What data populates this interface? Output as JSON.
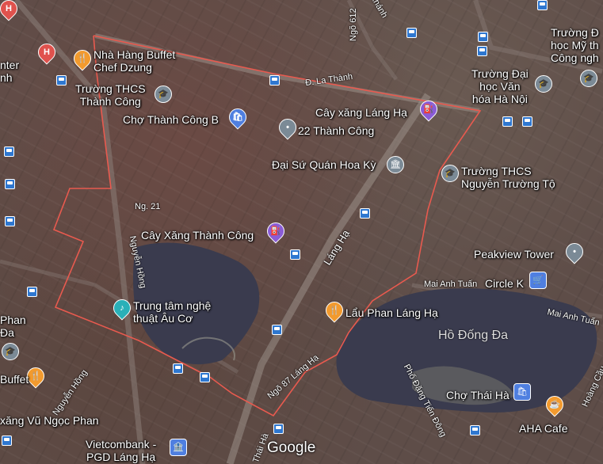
{
  "map": {
    "boundary_color": "#e85a4f",
    "water_color": "#3a3b4e",
    "attribution": "Google"
  },
  "places": [
    {
      "id": "buffet",
      "text": "Nhà Hàng Buffet\nChef Dzung",
      "icon": "restaurant-icon",
      "color": "#f29a2e"
    },
    {
      "id": "thcs-tc",
      "text": "Trường THCS\nThành Công",
      "icon": "school-icon",
      "color": "#7b8a96"
    },
    {
      "id": "cho-tc",
      "text": "Chợ Thành Công B",
      "icon": "shopping-icon",
      "color": "#4f7fe0"
    },
    {
      "id": "22tc",
      "text": "22 Thành Công",
      "icon": "location-icon",
      "color": "#7b8a96"
    },
    {
      "id": "cayxang-lh",
      "text": "Cây xăng Láng Hạ",
      "icon": "gas-station-icon",
      "color": "#8a5cd6"
    },
    {
      "id": "dsq",
      "text": "Đại Sứ Quán Hoa Kỳ",
      "icon": "embassy-icon",
      "color": "#7b8a96"
    },
    {
      "id": "thcs-ntt",
      "text": "Trường THCS\nNguyễn Trường Tộ",
      "icon": "school-icon",
      "color": "#7b8a96"
    },
    {
      "id": "daihoc",
      "text": "Trường Đại\nhọc Văn\nhóa Hà Nội",
      "icon": "school-icon",
      "color": "#7b8a96"
    },
    {
      "id": "mythuat",
      "text": "Trường Đ\nhọc Mỹ th\nCông ngh",
      "icon": "school-icon",
      "color": "#7b8a96"
    },
    {
      "id": "cayxang-tc",
      "text": "Cây Xăng Thành Công",
      "icon": "gas-station-icon",
      "color": "#8a5cd6"
    },
    {
      "id": "peakview",
      "text": "Peakview Tower",
      "icon": "location-icon",
      "color": "#7b8a96"
    },
    {
      "id": "circlek",
      "text": "Circle K",
      "icon": "store-icon",
      "color": "#4f7fe0"
    },
    {
      "id": "auco",
      "text": "Trung tâm nghệ\nthuật Âu Cơ",
      "icon": "arts-icon",
      "color": "#2ab0b8"
    },
    {
      "id": "lau",
      "text": "Lẩu Phan Láng Hạ",
      "icon": "restaurant-icon",
      "color": "#f29a2e"
    },
    {
      "id": "chothaiha",
      "text": "Chợ Thái Hà",
      "icon": "shopping-icon",
      "color": "#4f7fe0"
    },
    {
      "id": "aha",
      "text": "AHA Cafe",
      "icon": "cafe-icon",
      "color": "#f29a2e"
    },
    {
      "id": "vcb",
      "text": "Vietcombank -\nPGD Láng Hạ",
      "icon": "bank-icon",
      "color": "#4f7fe0"
    },
    {
      "id": "xang-vnp",
      "text": "xăng Vũ Ngọc Phan",
      "icon": "gas-station-icon",
      "color": "#8a5cd6"
    },
    {
      "id": "phan",
      "text": "Phan\nĐa",
      "icon": "location-icon",
      "color": "#7b8a96"
    },
    {
      "id": "buffet-left",
      "text": "Buffet",
      "icon": "restaurant-icon",
      "color": "#f29a2e"
    },
    {
      "id": "center",
      "text": "nter\nnh",
      "icon": "hospital-icon",
      "color": "#e0524d"
    }
  ],
  "roads": {
    "la_thanh": "Đ. La Thành",
    "ngo612": "Ngõ 612",
    "khanh": "Khánh",
    "lang_ha": "Láng Hạ",
    "ng21": "Ng. 21",
    "nguyen_hong_1": "Nguyễn Hồng",
    "nguyen_hong_2": "Nguyễn Hồng",
    "ngo87": "Ngõ 87 Láng Hạ",
    "mai_anh_tuan_1": "Mai Anh Tuấn",
    "mai_anh_tuan_2": "Mai Anh Tuấn",
    "pho_dang_tien_dong": "Phố Đặng Tiến Đông",
    "hoang_cau": "Hoàng Cầu",
    "thai_ha": "Thái Hà"
  },
  "lakes": {
    "ho_dong_da": "Hồ Đống Đa"
  }
}
